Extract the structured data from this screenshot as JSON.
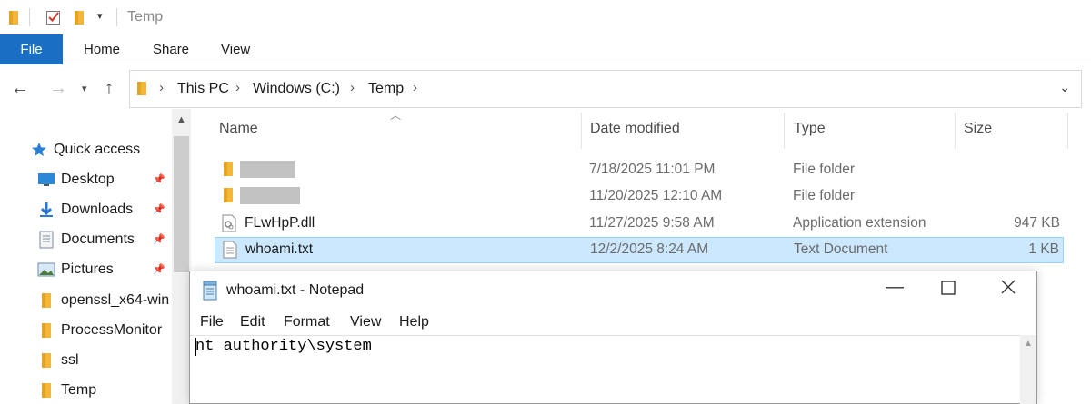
{
  "window": {
    "title": "Temp"
  },
  "ribbon": {
    "tabs": [
      "File",
      "Home",
      "Share",
      "View"
    ]
  },
  "address": {
    "crumbs": [
      "This PC",
      "Windows (C:)",
      "Temp"
    ]
  },
  "nav": {
    "quick_access": "Quick access",
    "items": [
      {
        "label": "Desktop",
        "icon": "desktop-icon",
        "pinned": true
      },
      {
        "label": "Downloads",
        "icon": "downloads-icon",
        "pinned": true
      },
      {
        "label": "Documents",
        "icon": "documents-icon",
        "pinned": true
      },
      {
        "label": "Pictures",
        "icon": "pictures-icon",
        "pinned": true
      },
      {
        "label": "openssl_x64-win",
        "icon": "folder-icon",
        "pinned": false
      },
      {
        "label": "ProcessMonitor",
        "icon": "folder-icon",
        "pinned": false
      },
      {
        "label": "ssl",
        "icon": "folder-icon",
        "pinned": false
      },
      {
        "label": "Temp",
        "icon": "folder-icon",
        "pinned": false
      }
    ]
  },
  "list": {
    "columns": {
      "name": "Name",
      "date": "Date modified",
      "type": "Type",
      "size": "Size"
    },
    "rows": [
      {
        "name": "",
        "redacted": true,
        "date": "7/18/2025 11:01 PM",
        "type": "File folder",
        "size": "",
        "icon": "folder-icon"
      },
      {
        "name": "",
        "redacted": true,
        "date": "11/20/2025 12:10 AM",
        "type": "File folder",
        "size": "",
        "icon": "folder-icon"
      },
      {
        "name": "FLwHpP.dll",
        "redacted": false,
        "date": "11/27/2025 9:58 AM",
        "type": "Application extension",
        "size": "947 KB",
        "icon": "dll-file-icon"
      },
      {
        "name": "whoami.txt",
        "redacted": false,
        "date": "12/2/2025 8:24 AM",
        "type": "Text Document",
        "size": "1 KB",
        "icon": "text-file-icon",
        "selected": true
      }
    ]
  },
  "notepad": {
    "title": "whoami.txt - Notepad",
    "menu": [
      "File",
      "Edit",
      "Format",
      "View",
      "Help"
    ],
    "content": "nt authority\\system"
  },
  "colors": {
    "accent": "#1a6fc4",
    "selection": "#cce8ff",
    "folder": "#f8c44f"
  }
}
